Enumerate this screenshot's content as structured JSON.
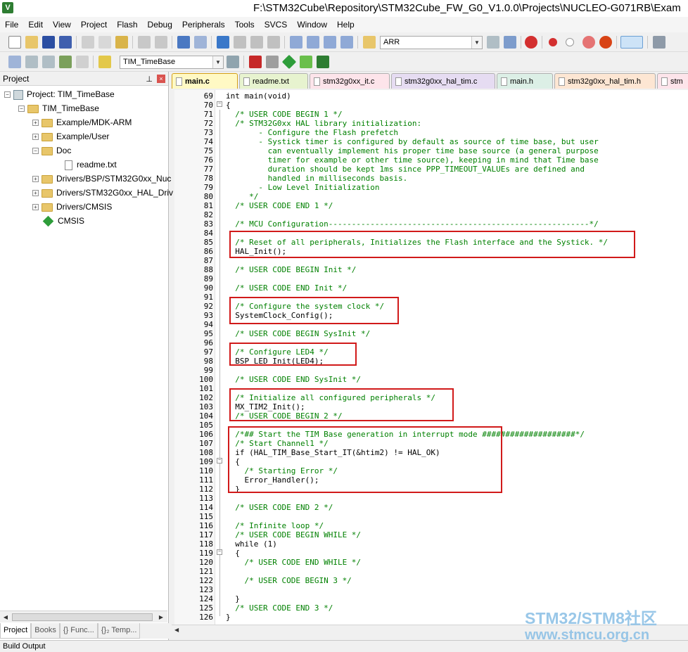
{
  "window": {
    "title": "F:\\STM32Cube\\Repository\\STM32Cube_FW_G0_V1.0.0\\Projects\\NUCLEO-G071RB\\Exam",
    "app_icon": "keil-uvision-icon"
  },
  "menu": [
    "File",
    "Edit",
    "View",
    "Project",
    "Flash",
    "Debug",
    "Peripherals",
    "Tools",
    "SVCS",
    "Window",
    "Help"
  ],
  "toolbar": {
    "find_combo": "ARR",
    "target_combo": "TIM_TimeBase"
  },
  "project_panel": {
    "title": "Project",
    "pin": "⊥",
    "close": "×",
    "root": "Project: TIM_TimeBase",
    "target": "TIM_TimeBase",
    "groups": [
      "Example/MDK-ARM",
      "Example/User",
      "Doc",
      "Drivers/BSP/STM32G0xx_Nuc",
      "Drivers/STM32G0xx_HAL_Driv",
      "Drivers/CMSIS"
    ],
    "doc_file": "readme.txt",
    "cmsis": "CMSIS"
  },
  "panel_tabs": [
    "Project",
    "Books",
    "{} Func...",
    "{}₂ Temp..."
  ],
  "editor_tabs": [
    {
      "label": "main.c",
      "color": "#fff9c4",
      "active": true
    },
    {
      "label": "readme.txt",
      "color": "#e7f3cf"
    },
    {
      "label": "stm32g0xx_it.c",
      "color": "#fde4ea"
    },
    {
      "label": "stm32g0xx_hal_tim.c",
      "color": "#e6dcf2"
    },
    {
      "label": "main.h",
      "color": "#dcefe6"
    },
    {
      "label": "stm32g0xx_hal_tim.h",
      "color": "#fde6d3"
    },
    {
      "label": "stm",
      "color": "#fde4ea"
    }
  ],
  "code_lines": [
    {
      "n": "69",
      "t": "int main(void)",
      "c": false
    },
    {
      "n": "70",
      "t": "{",
      "c": false
    },
    {
      "n": "71",
      "t": "  /* USER CODE BEGIN 1 */",
      "c": true
    },
    {
      "n": "72",
      "t": "  /* STM32G0xx HAL library initialization:",
      "c": true
    },
    {
      "n": "73",
      "t": "       - Configure the Flash prefetch",
      "c": true
    },
    {
      "n": "74",
      "t": "       - Systick timer is configured by default as source of time base, but user",
      "c": true
    },
    {
      "n": "75",
      "t": "         can eventually implement his proper time base source (a general purpose",
      "c": true
    },
    {
      "n": "76",
      "t": "         timer for example or other time source), keeping in mind that Time base",
      "c": true
    },
    {
      "n": "77",
      "t": "         duration should be kept 1ms since PPP_TIMEOUT_VALUEs are defined and",
      "c": true
    },
    {
      "n": "78",
      "t": "         handled in milliseconds basis.",
      "c": true
    },
    {
      "n": "79",
      "t": "       - Low Level Initialization",
      "c": true
    },
    {
      "n": "80",
      "t": "     */",
      "c": true
    },
    {
      "n": "81",
      "t": "  /* USER CODE END 1 */",
      "c": true
    },
    {
      "n": "82",
      "t": "",
      "c": false
    },
    {
      "n": "83",
      "t": "  /* MCU Configuration--------------------------------------------------------*/",
      "c": true
    },
    {
      "n": "84",
      "t": "",
      "c": false
    },
    {
      "n": "85",
      "t": "  /* Reset of all peripherals, Initializes the Flash interface and the Systick. */",
      "c": true
    },
    {
      "n": "86",
      "t": "  HAL_Init();",
      "c": false
    },
    {
      "n": "87",
      "t": "",
      "c": false
    },
    {
      "n": "88",
      "t": "  /* USER CODE BEGIN Init */",
      "c": true
    },
    {
      "n": "89",
      "t": "",
      "c": false
    },
    {
      "n": "90",
      "t": "  /* USER CODE END Init */",
      "c": true
    },
    {
      "n": "91",
      "t": "",
      "c": false
    },
    {
      "n": "92",
      "t": "  /* Configure the system clock */",
      "c": true
    },
    {
      "n": "93",
      "t": "  SystemClock_Config();",
      "c": false
    },
    {
      "n": "94",
      "t": "",
      "c": false
    },
    {
      "n": "95",
      "t": "  /* USER CODE BEGIN SysInit */",
      "c": true
    },
    {
      "n": "96",
      "t": "",
      "c": false
    },
    {
      "n": "97",
      "t": "  /* Configure LED4 */",
      "c": true
    },
    {
      "n": "98",
      "t": "  BSP_LED_Init(LED4);",
      "c": false
    },
    {
      "n": "99",
      "t": "",
      "c": false
    },
    {
      "n": "100",
      "t": "  /* USER CODE END SysInit */",
      "c": true
    },
    {
      "n": "101",
      "t": "",
      "c": false
    },
    {
      "n": "102",
      "t": "  /* Initialize all configured peripherals */",
      "c": true
    },
    {
      "n": "103",
      "t": "  MX_TIM2_Init();",
      "c": false
    },
    {
      "n": "104",
      "t": "  /* USER CODE BEGIN 2 */",
      "c": true
    },
    {
      "n": "105",
      "t": "",
      "c": false
    },
    {
      "n": "106",
      "t": "  /*## Start the TIM Base generation in interrupt mode ####################*/",
      "c": true
    },
    {
      "n": "107",
      "t": "  /* Start Channel1 */",
      "c": true
    },
    {
      "n": "108",
      "t": "  if (HAL_TIM_Base_Start_IT(&htim2) != HAL_OK)",
      "c": false
    },
    {
      "n": "109",
      "t": "  {",
      "c": false
    },
    {
      "n": "110",
      "t": "    /* Starting Error */",
      "c": true
    },
    {
      "n": "111",
      "t": "    Error_Handler();",
      "c": false
    },
    {
      "n": "112",
      "t": "  }",
      "c": false
    },
    {
      "n": "113",
      "t": "",
      "c": false
    },
    {
      "n": "114",
      "t": "  /* USER CODE END 2 */",
      "c": true
    },
    {
      "n": "115",
      "t": "",
      "c": false
    },
    {
      "n": "116",
      "t": "  /* Infinite loop */",
      "c": true
    },
    {
      "n": "117",
      "t": "  /* USER CODE BEGIN WHILE */",
      "c": true
    },
    {
      "n": "118",
      "t": "  while (1)",
      "c": false
    },
    {
      "n": "119",
      "t": "  {",
      "c": false
    },
    {
      "n": "120",
      "t": "    /* USER CODE END WHILE */",
      "c": true
    },
    {
      "n": "121",
      "t": "",
      "c": false
    },
    {
      "n": "122",
      "t": "    /* USER CODE BEGIN 3 */",
      "c": true
    },
    {
      "n": "123",
      "t": "",
      "c": false
    },
    {
      "n": "124",
      "t": "  }",
      "c": false
    },
    {
      "n": "125",
      "t": "  /* USER CODE END 3 */",
      "c": true
    },
    {
      "n": "126",
      "t": "}",
      "c": false
    }
  ],
  "status": {
    "label": "Build Output"
  },
  "watermark": {
    "line1": "STM32/STM8社区",
    "line2": "www.stmcu.org.cn"
  },
  "colors": {
    "comment": "#008000",
    "highlight_box": "#d11a1a",
    "current_line": "#e8f9e8"
  }
}
